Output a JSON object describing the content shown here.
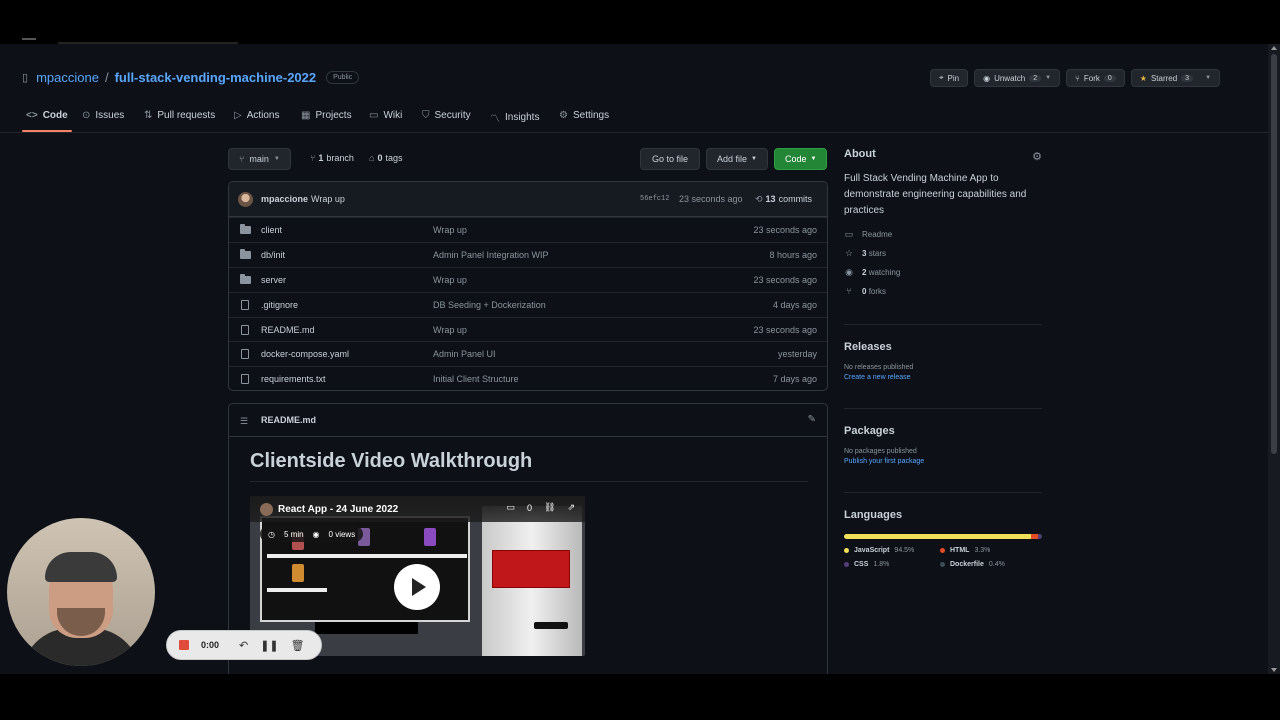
{
  "repo": {
    "owner": "mpaccione",
    "slash": "/",
    "name": "full-stack-vending-machine-2022",
    "visibility": "Public"
  },
  "actions": {
    "pin": "Pin",
    "unwatch": "Unwatch",
    "unwatch_count": "2",
    "fork": "Fork",
    "fork_count": "0",
    "starred": "Starred",
    "star_count": "3"
  },
  "tabs": [
    {
      "label": "Code",
      "icon": "code-icon"
    },
    {
      "label": "Issues",
      "icon": "issue-icon"
    },
    {
      "label": "Pull requests",
      "icon": "pull-request-icon"
    },
    {
      "label": "Actions",
      "icon": "play-icon"
    },
    {
      "label": "Projects",
      "icon": "table-icon"
    },
    {
      "label": "Wiki",
      "icon": "book-icon"
    },
    {
      "label": "Security",
      "icon": "shield-icon"
    },
    {
      "label": "Insights",
      "icon": "graph-icon"
    },
    {
      "label": "Settings",
      "icon": "gear-icon"
    }
  ],
  "branchbar": {
    "branch": "main",
    "branch_count": "1",
    "branch_word": "branch",
    "tag_count": "0",
    "tag_word": "tags",
    "go_to_file": "Go to file",
    "add_file": "Add file",
    "code": "Code"
  },
  "commit": {
    "author": "mpaccione",
    "message": "Wrap up",
    "sha": "56efc12",
    "time": "23 seconds ago",
    "count": "13",
    "count_word": "commits"
  },
  "files": [
    {
      "type": "dir",
      "name": "client",
      "message": "Wrap up",
      "time": "23 seconds ago"
    },
    {
      "type": "dir",
      "name": "db/init",
      "message": "Admin Panel Integration WIP",
      "time": "8 hours ago"
    },
    {
      "type": "dir",
      "name": "server",
      "message": "Wrap up",
      "time": "23 seconds ago"
    },
    {
      "type": "file",
      "name": ".gitignore",
      "message": "DB Seeding + Dockerization",
      "time": "4 days ago"
    },
    {
      "type": "file",
      "name": "README.md",
      "message": "Wrap up",
      "time": "23 seconds ago"
    },
    {
      "type": "file",
      "name": "docker-compose.yaml",
      "message": "Admin Panel UI",
      "time": "yesterday"
    },
    {
      "type": "file",
      "name": "requirements.txt",
      "message": "Initial Client Structure",
      "time": "7 days ago"
    }
  ],
  "readme": {
    "title": "README.md",
    "heading": "Clientside Video Walkthrough",
    "video": {
      "title": "React App - 24 June 2022",
      "duration": "5 min",
      "views": "0 views",
      "comments": "0"
    }
  },
  "about": {
    "heading": "About",
    "description": "Full Stack Vending Machine App to demonstrate engineering capabilities and practices",
    "readme": "Readme",
    "stars_count": "3",
    "stars_word": "stars",
    "watching_count": "2",
    "watching_word": "watching",
    "forks_count": "0",
    "forks_word": "forks"
  },
  "releases": {
    "heading": "Releases",
    "none": "No releases published",
    "link": "Create a new release"
  },
  "packages": {
    "heading": "Packages",
    "none": "No packages published",
    "link": "Publish your first package"
  },
  "languages": {
    "heading": "Languages",
    "items": [
      {
        "name": "JavaScript",
        "percent": "94.5%",
        "value": 94.5,
        "color": "#f1e05a"
      },
      {
        "name": "HTML",
        "percent": "3.3%",
        "value": 3.3,
        "color": "#e34c26"
      },
      {
        "name": "CSS",
        "percent": "1.8%",
        "value": 1.8,
        "color": "#563d7c"
      },
      {
        "name": "Dockerfile",
        "percent": "0.4%",
        "value": 0.4,
        "color": "#384d54"
      }
    ]
  },
  "recorder": {
    "time": "0:00"
  }
}
